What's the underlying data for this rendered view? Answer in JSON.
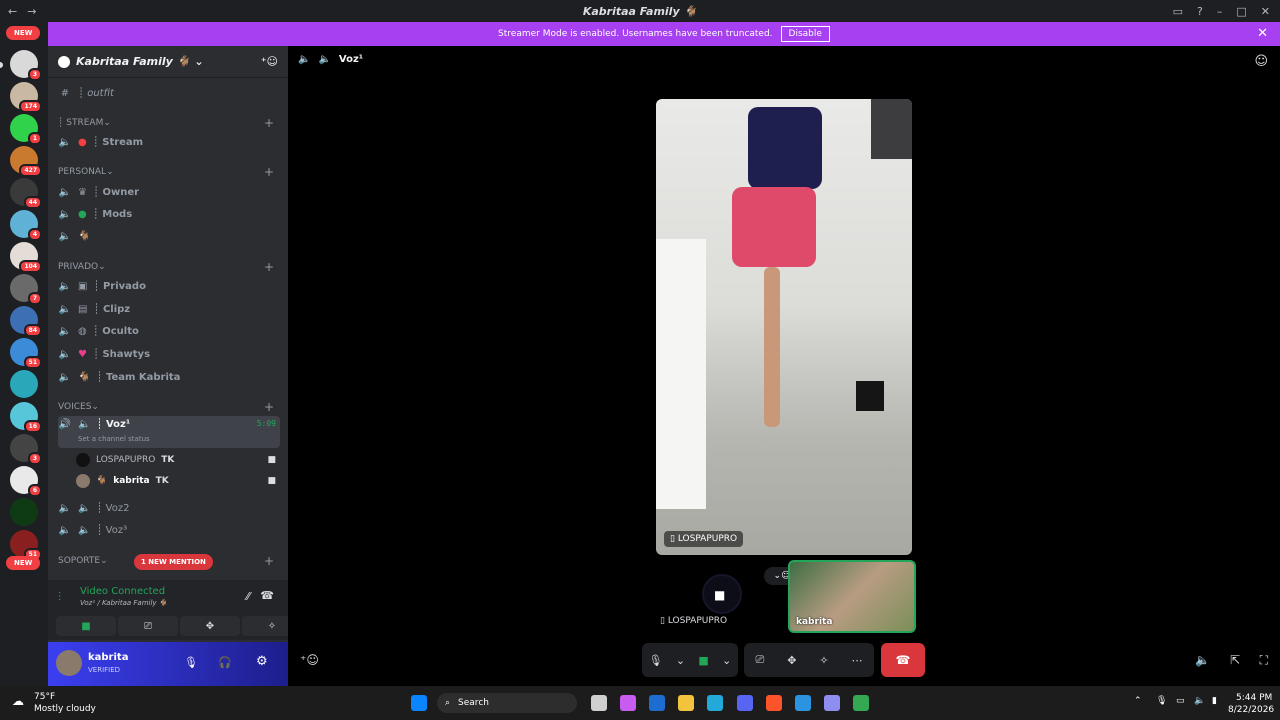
{
  "window": {
    "title": "Kabritaa Family 🐐",
    "back": "←",
    "forward": "→"
  },
  "banner": {
    "text": "Streamer Mode is enabled. Usernames have been truncated.",
    "button": "Disable"
  },
  "servers": {
    "new_top": "NEW",
    "new_bottom": "NEW",
    "badges": [
      "3",
      "174",
      "1",
      "427",
      "44",
      "4",
      "104",
      "7",
      "84",
      "51",
      "16",
      "3",
      "6",
      "51"
    ]
  },
  "guild": {
    "name": "Kabritaa Family 🐐"
  },
  "channels": {
    "outfit": "┊ outfit",
    "cat_stream": "┊ STREAM",
    "stream": "┊ Stream",
    "cat_personal": "PERSONAL",
    "owner": "┊ Owner",
    "mods": "┊ Mods",
    "goat": "",
    "cat_privado": "PRIVADO",
    "privado": "┊ Privado",
    "clipz": "┊ Clipz",
    "oculto": "┊ Oculto",
    "shawtys": "┊ Shawtys",
    "team": "┊ Team Kabrita",
    "cat_voices": "VOICES",
    "voz1": "┊ Voz¹",
    "voz1_timer": "5:09",
    "voz1_status": "Set a channel status",
    "user1": "LOSPAPUPRO",
    "user1_tag": "TK",
    "user2": "kabrita",
    "user2_tag": "TK",
    "voz2": "┊ Voz2",
    "voz3": "┊ Voz³",
    "cat_soporte": "SOPORTE",
    "mention": "1 NEW MENTION"
  },
  "voice_panel": {
    "status": "Video Connected",
    "location": "Voz¹ / Kabritaa Family 🐐"
  },
  "user_panel": {
    "name": "kabrita",
    "status": "VERIFIED"
  },
  "main": {
    "channel": "Voz¹",
    "video_label": "LOSPAPUPRO",
    "tile1_label": "LOSPAPUPRO",
    "tile2_label": "kabrita"
  },
  "taskbar": {
    "temp": "75°F",
    "weather": "Mostly cloudy",
    "search": "Search",
    "time": "5:44 PM",
    "date": "8/22/2026"
  },
  "colors": {
    "accent": "#a640f0",
    "brand": "#5865f2",
    "green": "#23a55a",
    "red": "#da373c"
  }
}
